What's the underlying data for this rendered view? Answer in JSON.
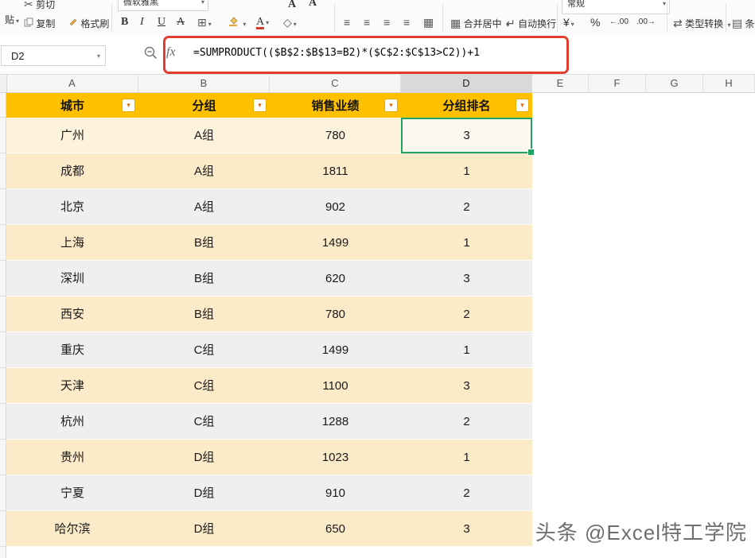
{
  "toolbar": {
    "paste_label": "贴",
    "cut_label": "剪切",
    "copy_label": "复制",
    "format_painter_label": "格式刷",
    "font_name": "微软雅黑",
    "bold_label": "B",
    "italic_label": "I",
    "underline_label": "U",
    "strike_label": "A",
    "font_color_label": "A",
    "size_up_label": "A",
    "size_down_label": "A",
    "merge_center_label": "合并居中",
    "wrap_label": "自动换行",
    "number_format_value": "常规",
    "currency_label": "¥",
    "percent_label": "%",
    "decimal_inc_label": "←.00",
    "decimal_dec_label": ".00→",
    "type_convert_label": "类型转换",
    "conditional_label": "条件格式"
  },
  "icons": {
    "dropdown": "▾",
    "scissors": "✂",
    "align": "≡",
    "borders": "⊞",
    "shading": "◇",
    "merge": "▦",
    "wrap": "↵",
    "convert": "⇄",
    "conditional": "▤"
  },
  "formula_bar": {
    "cell_ref": "D2",
    "fx_label": "fx",
    "formula": "=SUMPRODUCT(($B$2:$B$13=B2)*($C$2:$C$13>C2))+1"
  },
  "grid": {
    "column_headers": [
      "A",
      "B",
      "C",
      "D",
      "E",
      "F",
      "G",
      "H"
    ],
    "selected_column": "D",
    "selected_row_index": 0,
    "selected_col_index": 3
  },
  "table": {
    "headers": [
      "城市",
      "分组",
      "销售业绩",
      "分组排名"
    ],
    "rows": [
      [
        "广州",
        "A组",
        "780",
        "3"
      ],
      [
        "成都",
        "A组",
        "1811",
        "1"
      ],
      [
        "北京",
        "A组",
        "902",
        "2"
      ],
      [
        "上海",
        "B组",
        "1499",
        "1"
      ],
      [
        "深圳",
        "B组",
        "620",
        "3"
      ],
      [
        "西安",
        "B组",
        "780",
        "2"
      ],
      [
        "重庆",
        "C组",
        "1499",
        "1"
      ],
      [
        "天津",
        "C组",
        "1100",
        "3"
      ],
      [
        "杭州",
        "C组",
        "1288",
        "2"
      ],
      [
        "贵州",
        "D组",
        "1023",
        "1"
      ],
      [
        "宁夏",
        "D组",
        "910",
        "2"
      ],
      [
        "哈尔滨",
        "D组",
        "650",
        "3"
      ]
    ]
  },
  "watermark": "头条 @Excel特工学院",
  "colors": {
    "header_fill": "#FFC000",
    "band_cream": "#FCEBC9",
    "band_gray": "#EFEFEF",
    "selection_green": "#1FA463",
    "annotation_red": "#E23E30"
  }
}
